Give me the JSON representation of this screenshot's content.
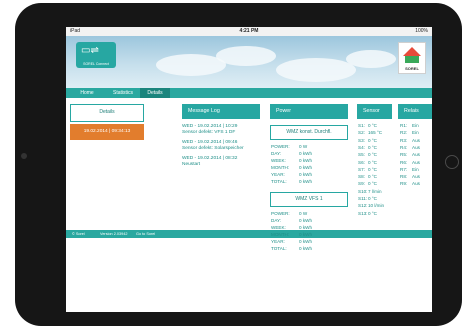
{
  "status": {
    "carrier": "iPad",
    "time": "4:21 PM",
    "battery": "100%"
  },
  "brand": {
    "left_logo_text": "SOREL Connect",
    "right_logo_text": "SOREL"
  },
  "nav": {
    "tabs": [
      "Home",
      "Statistics",
      "Details"
    ],
    "active": "Details"
  },
  "details": {
    "title": "Details",
    "date": "19.02.2014 | 09:34:13"
  },
  "messages": {
    "title": "Message Log",
    "items": [
      {
        "time": "WED - 19.02.2014 | 10:29",
        "text": "Sensor defekt: VFS 1 DF"
      },
      {
        "time": "WED - 19.02.2014 | 09:46",
        "text": "Sensor defekt: Solarspeicher"
      },
      {
        "time": "WED - 19.02.2014 | 08:32",
        "text": "Neustart"
      }
    ]
  },
  "power": {
    "title": "Power",
    "groups": [
      {
        "name": "WMZ konst. Durchfl.",
        "rows": [
          {
            "label": "POWER:",
            "value": "0 W"
          },
          {
            "label": "DAY:",
            "value": "0 kWh"
          },
          {
            "label": "WEEK:",
            "value": "0 kWh"
          },
          {
            "label": "MONTH:",
            "value": "0 kWh"
          },
          {
            "label": "YEAR:",
            "value": "0 kWh"
          },
          {
            "label": "TOTAL:",
            "value": "0 kWh"
          }
        ]
      },
      {
        "name": "WMZ VFS 1",
        "rows": [
          {
            "label": "POWER:",
            "value": "0 W"
          },
          {
            "label": "DAY:",
            "value": "0 kWh"
          },
          {
            "label": "WEEK:",
            "value": "0 kWh"
          },
          {
            "label": "MONTH:",
            "value": "0 kWh"
          },
          {
            "label": "YEAR:",
            "value": "0 kWh"
          },
          {
            "label": "TOTAL:",
            "value": "0 kWh"
          }
        ]
      }
    ]
  },
  "sensor": {
    "title": "Sensor",
    "rows": [
      {
        "label": "S1:",
        "value": "0 °C"
      },
      {
        "label": "S2:",
        "value": "165 °C"
      },
      {
        "label": "S3:",
        "value": "0 °C"
      },
      {
        "label": "S4:",
        "value": "0 °C"
      },
      {
        "label": "S5:",
        "value": "0 °C"
      },
      {
        "label": "S6:",
        "value": "0 °C"
      },
      {
        "label": "S7:",
        "value": "0 °C"
      },
      {
        "label": "S8:",
        "value": "0 °C"
      },
      {
        "label": "S9:",
        "value": "0 °C"
      },
      {
        "label": "S10:",
        "value": "7 l/min"
      },
      {
        "label": "S11:",
        "value": "0 °C"
      },
      {
        "label": "S12:",
        "value": "10 l/min"
      },
      {
        "label": "S13:",
        "value": "0 °C"
      }
    ]
  },
  "relais": {
    "title": "Relais",
    "rows": [
      {
        "label": "R1:",
        "value": "Ein"
      },
      {
        "label": "R2:",
        "value": "Ein"
      },
      {
        "label": "R3:",
        "value": "Aus"
      },
      {
        "label": "R4:",
        "value": "Aus"
      },
      {
        "label": "R5:",
        "value": "Aus"
      },
      {
        "label": "R6:",
        "value": "Aus"
      },
      {
        "label": "R7:",
        "value": "Ein"
      },
      {
        "label": "R8:",
        "value": "Aus"
      },
      {
        "label": "R9:",
        "value": "Aus"
      }
    ]
  },
  "footer": {
    "left": "© Sorel",
    "version": "Version 2.03942",
    "link": "Go to Sorel"
  }
}
